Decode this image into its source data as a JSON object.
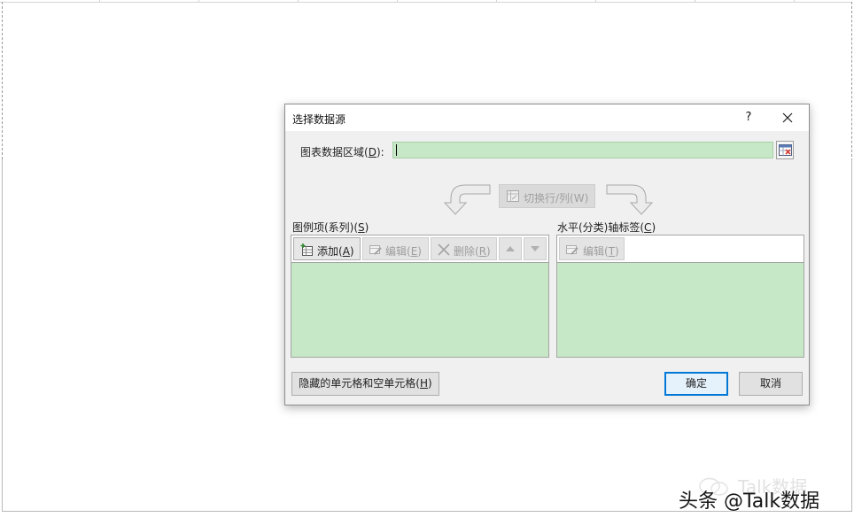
{
  "dialog": {
    "title": "选择数据源",
    "help": "?",
    "chart_range_label_pre": "图表数据区域(",
    "chart_range_label_key": "D",
    "chart_range_label_post": "):",
    "chart_range_value": "",
    "switch_label": "切换行/列(W)",
    "legend": {
      "title_pre": "图例项(系列)(",
      "title_key": "S",
      "title_post": ")",
      "add_pre": "添加(",
      "add_key": "A",
      "add_post": ")",
      "edit_pre": "编辑(",
      "edit_key": "E",
      "edit_post": ")",
      "delete_pre": "删除(",
      "delete_key": "R",
      "delete_post": ")",
      "items": []
    },
    "axis": {
      "title_pre": "水平(分类)轴标签(",
      "title_key": "C",
      "title_post": ")",
      "edit_pre": "编辑(",
      "edit_key": "T",
      "edit_post": ")",
      "items": []
    },
    "hidden_cells_pre": "隐藏的单元格和空单元格(",
    "hidden_cells_key": "H",
    "hidden_cells_post": ")",
    "ok": "确定",
    "cancel": "取消"
  },
  "watermark": {
    "faint": "Talk数据",
    "main": "头条 @Talk数据"
  },
  "colors": {
    "highlight_green": "#c6e8c6",
    "focus_blue": "#0078d7"
  }
}
